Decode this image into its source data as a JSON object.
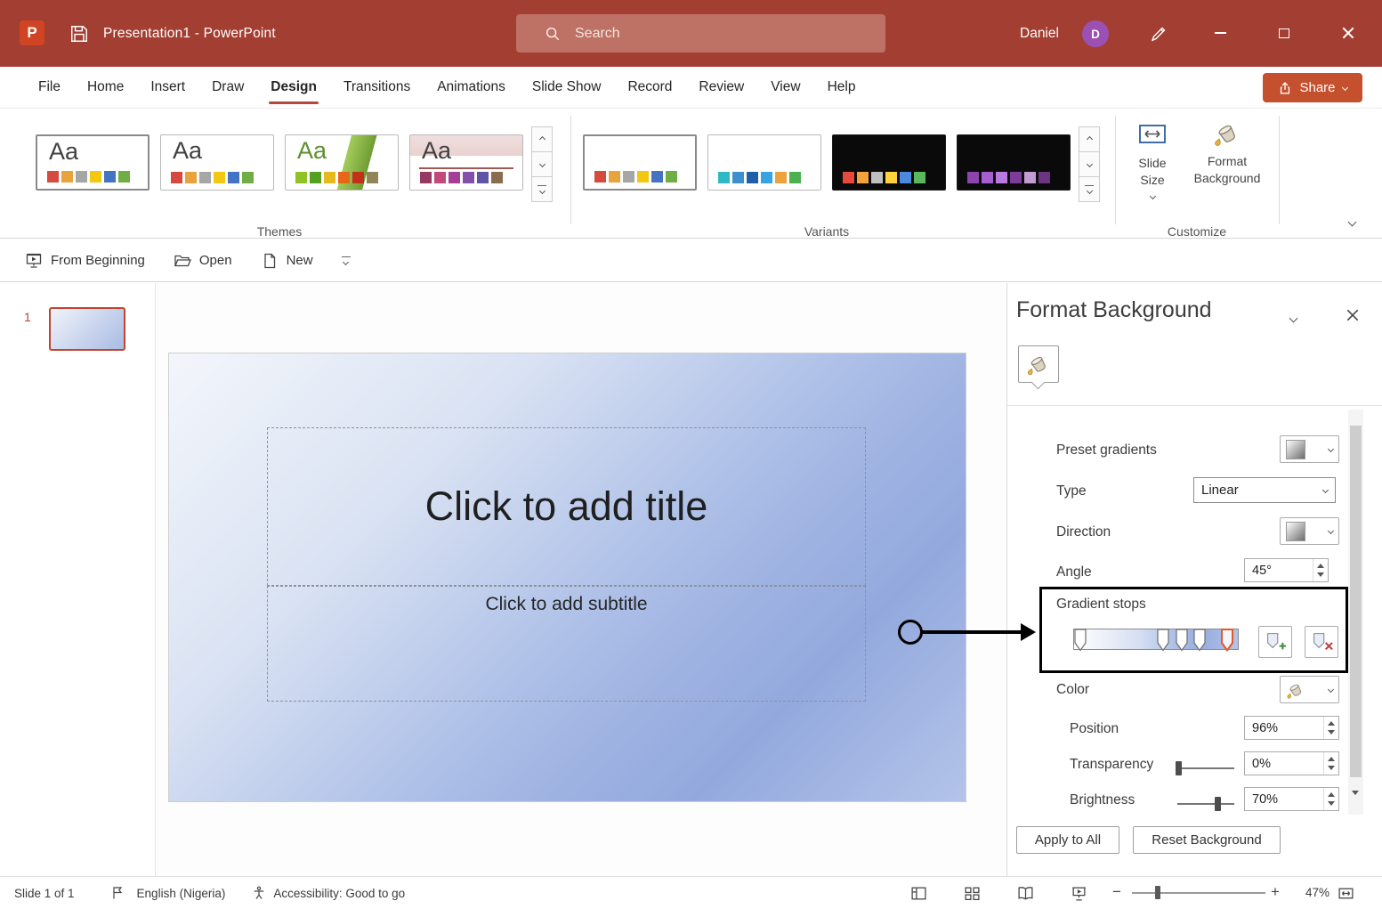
{
  "titlebar": {
    "logo_letter": "P",
    "title": "Presentation1  -  PowerPoint",
    "search_placeholder": "Search",
    "user_name": "Daniel",
    "user_initial": "D"
  },
  "menubar": {
    "items": [
      "File",
      "Home",
      "Insert",
      "Draw",
      "Design",
      "Transitions",
      "Animations",
      "Slide Show",
      "Record",
      "Review",
      "View",
      "Help"
    ],
    "active_item": "Design",
    "share_label": "Share"
  },
  "ribbon": {
    "theme_glyph": "Aa",
    "themes_label": "Themes",
    "variants_label": "Variants",
    "customize_label": "Customize",
    "slide_size_label": "Slide Size",
    "format_background_label": "Format Background",
    "themes": [
      {
        "name": "theme-office",
        "colors": [
          "#D6493F",
          "#E8A33D",
          "#A6A6A6",
          "#F2C811",
          "#4472C4",
          "#70AD47"
        ]
      },
      {
        "name": "theme-office-alt",
        "colors": [
          "#D6493F",
          "#E8A33D",
          "#A6A6A6",
          "#F2C811",
          "#4472C4",
          "#70AD47"
        ]
      },
      {
        "name": "theme-facet-green",
        "colors": [
          "#90C226",
          "#54A021",
          "#E6B91E",
          "#E76618",
          "#C42F1A",
          "#918655"
        ]
      },
      {
        "name": "theme-berry",
        "colors": [
          "#963A63",
          "#C24A7A",
          "#A63D96",
          "#8250A8",
          "#5E55A5",
          "#8B6C4E"
        ]
      }
    ],
    "variants": [
      {
        "name": "variant-1",
        "colors": [
          "#D6493F",
          "#E8A33D",
          "#A6A6A6",
          "#F2C811",
          "#4472C4",
          "#70AD47"
        ]
      },
      {
        "name": "variant-2",
        "colors": [
          "#2FB8C5",
          "#3E8FD0",
          "#1F5FA8",
          "#37A3E0",
          "#EDA33B",
          "#4CAF50"
        ]
      },
      {
        "name": "variant-3",
        "colors": [
          "#E64A3C",
          "#F2A33C",
          "#BFBFBF",
          "#FFD23C",
          "#4A89DC",
          "#5CB85C"
        ]
      },
      {
        "name": "variant-4",
        "colors": [
          "#8E44AD",
          "#A55FD0",
          "#B97ADF",
          "#7D3C98",
          "#C39BD3",
          "#6C3483"
        ]
      }
    ]
  },
  "quickbar": {
    "from_beginning_label": "From Beginning",
    "open_label": "Open",
    "new_label": "New"
  },
  "slides_panel": {
    "slide_number": "1"
  },
  "slide": {
    "title_placeholder": "Click to add title",
    "subtitle_placeholder": "Click to add subtitle"
  },
  "format_pane": {
    "title": "Format Background",
    "preset_gradients_label": "Preset gradients",
    "type_label": "Type",
    "type_value": "Linear",
    "direction_label": "Direction",
    "angle_label": "Angle",
    "angle_value": "45°",
    "gradient_stops_label": "Gradient stops",
    "gradient_stops": {
      "positions": [
        0,
        54,
        66,
        78,
        96
      ],
      "selected_index": 4
    },
    "color_label": "Color",
    "position_label": "Position",
    "position_value": "96%",
    "transparency_label": "Transparency",
    "transparency_value": "0%",
    "brightness_label": "Brightness",
    "brightness_value": "70%",
    "apply_all_label": "Apply to All",
    "reset_label": "Reset Background"
  },
  "statusbar": {
    "slide_info": "Slide 1 of 1",
    "language": "English (Nigeria)",
    "accessibility": "Accessibility: Good to go",
    "zoom_value": "47%"
  },
  "colors": {
    "titlebar_bg": "#A33E32",
    "menu_accent": "#B5473C",
    "share_bg": "#C4502E",
    "avatar_bg": "#9B51B4",
    "selected_stop_outline": "#E05A2B",
    "slide_gradient": [
      "#F3F6FB",
      "#AFC1E8",
      "#93A9DE",
      "#AEBFE7"
    ]
  }
}
